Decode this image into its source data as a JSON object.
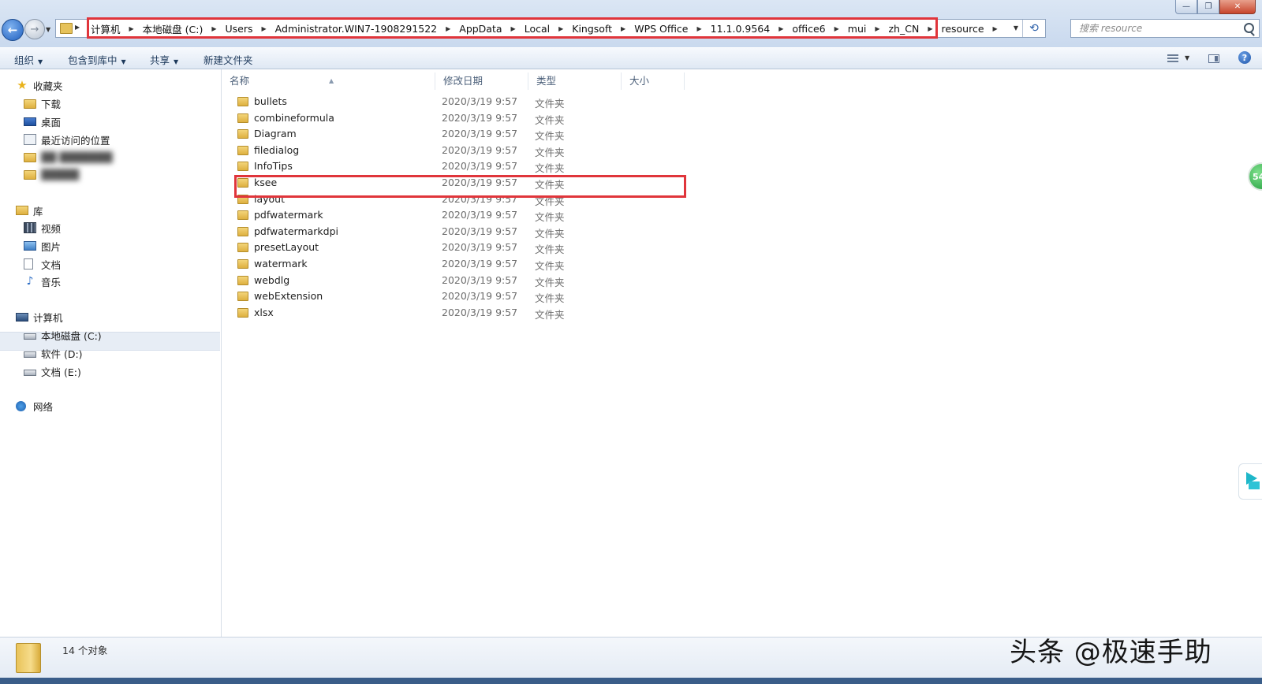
{
  "address_bar": {
    "breadcrumbs": [
      "计算机",
      "本地磁盘 (C:)",
      "Users",
      "Administrator.WIN7-1908291522",
      "AppData",
      "Local",
      "Kingsoft",
      "WPS Office",
      "11.1.0.9564",
      "office6",
      "mui",
      "zh_CN",
      "resource"
    ],
    "search_placeholder": "搜索 resource"
  },
  "toolbar": {
    "organize": "组织",
    "include_in_library": "包含到库中",
    "share": "共享",
    "new_folder": "新建文件夹"
  },
  "sidebar": {
    "favorites": {
      "label": "收藏夹",
      "items": [
        "下载",
        "桌面",
        "最近访问的位置",
        "",
        "",
        ""
      ]
    },
    "libraries": {
      "label": "库",
      "items": [
        "视频",
        "图片",
        "文档",
        "音乐"
      ]
    },
    "computer": {
      "label": "计算机",
      "items": [
        "本地磁盘 (C:)",
        "软件 (D:)",
        "文档 (E:)"
      ]
    },
    "network": {
      "label": "网络"
    }
  },
  "columns": {
    "name": "名称",
    "modified": "修改日期",
    "type": "类型",
    "size": "大小"
  },
  "files": [
    {
      "name": "bullets",
      "date": "2020/3/19 9:57",
      "type": "文件夹"
    },
    {
      "name": "combineformula",
      "date": "2020/3/19 9:57",
      "type": "文件夹"
    },
    {
      "name": "Diagram",
      "date": "2020/3/19 9:57",
      "type": "文件夹"
    },
    {
      "name": "filedialog",
      "date": "2020/3/19 9:57",
      "type": "文件夹"
    },
    {
      "name": "InfoTips",
      "date": "2020/3/19 9:57",
      "type": "文件夹"
    },
    {
      "name": "ksee",
      "date": "2020/3/19 9:57",
      "type": "文件夹"
    },
    {
      "name": "layout",
      "date": "2020/3/19 9:57",
      "type": "文件夹"
    },
    {
      "name": "pdfwatermark",
      "date": "2020/3/19 9:57",
      "type": "文件夹"
    },
    {
      "name": "pdfwatermarkdpi",
      "date": "2020/3/19 9:57",
      "type": "文件夹"
    },
    {
      "name": "presetLayout",
      "date": "2020/3/19 9:57",
      "type": "文件夹"
    },
    {
      "name": "watermark",
      "date": "2020/3/19 9:57",
      "type": "文件夹"
    },
    {
      "name": "webdlg",
      "date": "2020/3/19 9:57",
      "type": "文件夹"
    },
    {
      "name": "webExtension",
      "date": "2020/3/19 9:57",
      "type": "文件夹"
    },
    {
      "name": "xlsx",
      "date": "2020/3/19 9:57",
      "type": "文件夹"
    }
  ],
  "status": {
    "count": "14 个对象"
  },
  "overlays": {
    "badge": "54",
    "watermark": "头条 @极速手助"
  },
  "colors": {
    "highlight": "#e0353b",
    "accent": "#1f5fbf"
  }
}
